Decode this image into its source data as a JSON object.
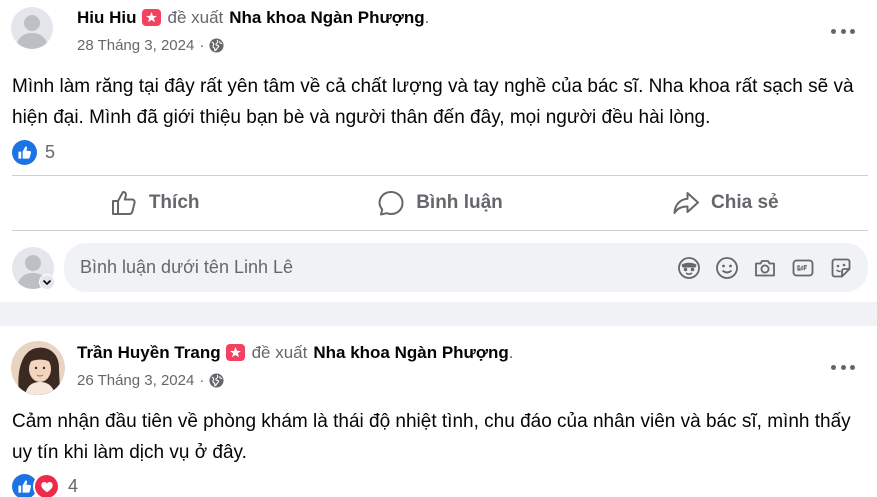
{
  "posts": [
    {
      "author": "Hiu Hiu",
      "verb": "đề xuất",
      "page": "Nha khoa Ngàn Phượng",
      "period": ".",
      "date": "28 Tháng 3, 2024",
      "separator": "·",
      "text": "Mình làm răng tại đây rất yên tâm về cả chất lượng và tay nghề của bác sĩ. Nha khoa rất sạch sẽ và hiện đại. Mình đã giới thiệu bạn bè và người thân đến đây, mọi người đều hài lòng.",
      "reaction_count": "5"
    },
    {
      "author": "Trần Huyền Trang",
      "verb": "đề xuất",
      "page": "Nha khoa Ngàn Phượng",
      "period": ".",
      "date": "26 Tháng 3, 2024",
      "separator": "·",
      "text": "Cảm nhận đầu tiên về phòng khám là thái độ nhiệt tình, chu đáo của nhân viên và bác sĩ, mình thấy uy tín khi làm dịch vụ ở đây.",
      "reaction_count": "4"
    }
  ],
  "actions": {
    "like": "Thích",
    "comment": "Bình luận",
    "share": "Chia sẻ"
  },
  "comment_box": {
    "placeholder": "Bình luận dưới tên Linh Lê"
  },
  "icons": {
    "recommend_badge": "star-badge-icon",
    "privacy": "globe-icon",
    "more": "more-options-icon",
    "comment_tools": [
      "avatar-sticker-icon",
      "emoji-icon",
      "camera-icon",
      "gif-icon",
      "sticker-icon"
    ]
  },
  "colors": {
    "accent_blue": "#1b74e4",
    "love_red": "#f02849",
    "badge_red": "#f3425f",
    "secondary_text": "#65676b",
    "page_bg": "#f0f2f5"
  }
}
